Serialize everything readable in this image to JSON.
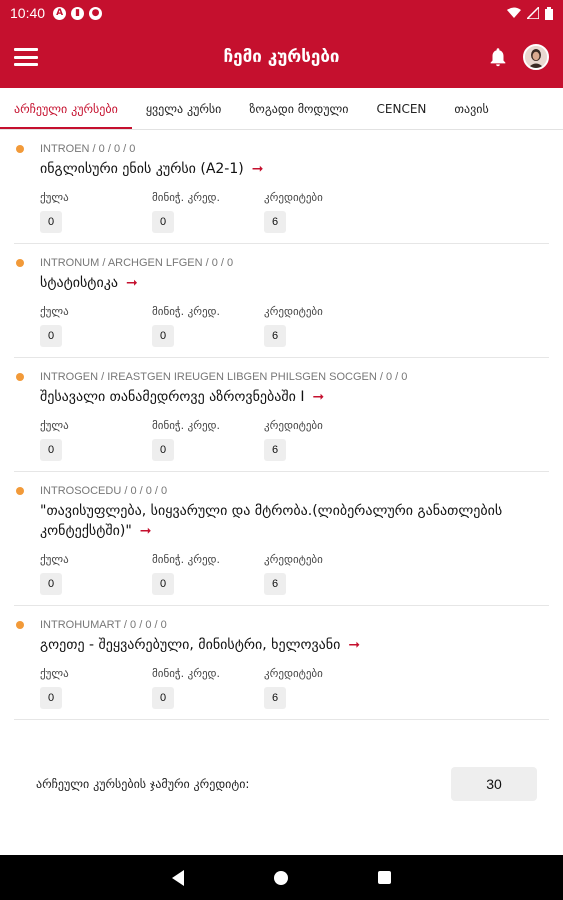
{
  "status": {
    "time": "10:40",
    "notification_icons": [
      "A",
      "▮",
      "●"
    ],
    "right_icons": [
      "wifi-icon",
      "signal-icon",
      "battery-icon"
    ]
  },
  "appbar": {
    "title": "ჩემი კურსები",
    "menu_icon": "hamburger-menu-icon",
    "bell_icon": "bell-icon",
    "avatar_icon": "user-avatar"
  },
  "tabs": [
    {
      "label": "არჩეული კურსები",
      "active": true
    },
    {
      "label": "ყველა კურსი",
      "active": false
    },
    {
      "label": "ზოგადი მოდული",
      "active": false
    },
    {
      "label": "CENCEN",
      "active": false
    },
    {
      "label": "თავის",
      "active": false
    }
  ],
  "labels": {
    "all": "ქულა",
    "min_credit": "მინიჭ. კრედ.",
    "credits": "კრედიტები"
  },
  "courses": [
    {
      "code": "INTROEN / 0 / 0 / 0",
      "name": "ინგლისური ენის კურსი (A2-1)",
      "score": "0",
      "min_credit": "0",
      "credits": "6"
    },
    {
      "code": "INTRONUM / ARCHGEN LFGEN / 0 / 0",
      "name": "სტატისტიკა",
      "score": "0",
      "min_credit": "0",
      "credits": "6"
    },
    {
      "code": "INTROGEN / IREASTGEN IREUGEN LIBGEN PHILSGEN SOCGEN / 0 / 0",
      "name": "შესავალი თანამედროვე აზროვნებაში I",
      "score": "0",
      "min_credit": "0",
      "credits": "6"
    },
    {
      "code": "INTROSOCEDU / 0 / 0 / 0",
      "name": "\"თავისუფლება, სიყვარული და მტრობა.(ლიბერალური განათლების კონტექსტში)\"",
      "score": "0",
      "min_credit": "0",
      "credits": "6"
    },
    {
      "code": "INTROHUMART / 0 / 0 / 0",
      "name": "გოეთე - შეყვარებული, მინისტრი, ხელოვანი",
      "score": "0",
      "min_credit": "0",
      "credits": "6"
    }
  ],
  "total": {
    "label": "არჩეული კურსების ჯამური კრედიტი:",
    "value": "30"
  },
  "colors": {
    "primary": "#c5102e",
    "dot": "#f29a39",
    "value_bg": "#eeeeee"
  }
}
